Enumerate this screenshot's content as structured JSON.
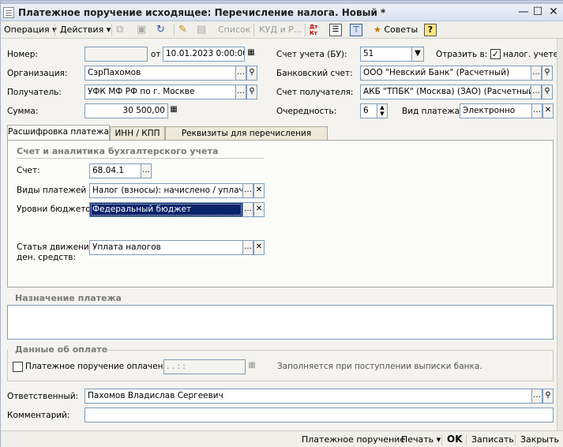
{
  "window": {
    "title": "Платежное поручение исходящее: Перечисление налога. Новый *",
    "controls": [
      "minimize-icon",
      "maximize-icon",
      "close-icon"
    ]
  },
  "toolbar": {
    "operation_label": "Операция",
    "actions_label": "Действия",
    "list_label": "Список",
    "kud_label": "КУД и Р...",
    "dt_kt_label": "Дт Кт",
    "advice_label": "Советы",
    "help_label": "?"
  },
  "header": {
    "number_label": "Номер:",
    "number_value": "",
    "from_label": "от",
    "date_value": "10.01.2023  0:00:00",
    "account_bu_label": "Счет учета (БУ):",
    "account_bu_value": "51",
    "reflect_label": "Отразить в:",
    "tax_account_checked": true,
    "tax_account_label": "налог. учете",
    "org_label": "Организация:",
    "org_value": "СэрПахомов",
    "bank_account_label": "Банковский счет:",
    "bank_account_value": "ООО \"Невский Банк\" (Расчетный)",
    "recipient_label": "Получатель:",
    "recipient_value": "УФК МФ РФ по г. Москве",
    "recipient_account_label": "Счет получателя:",
    "recipient_account_value": "АКБ \"ТПБК\" (Москва) (ЗАО) (Расчетный)",
    "sum_label": "Сумма:",
    "sum_value": "30 500,00",
    "priority_label": "Очередность:",
    "priority_value": "6",
    "payment_type_label": "Вид платежа:",
    "payment_type_value": "Электронно"
  },
  "tabs": [
    {
      "label": "Расшифровка платежа",
      "active": true
    },
    {
      "label": "ИНН / КПП",
      "active": false
    },
    {
      "label": "Реквизиты для перечисления налогов",
      "active": false
    }
  ],
  "panel": {
    "group_title": "Счет и аналитика бухгалтерского учета",
    "account_label": "Счет:",
    "account_value": "68.04.1",
    "payment_kinds_label": "Виды платежей ...",
    "payment_kinds_value": "Налог (взносы): начислено / уплачено",
    "budget_levels_label": "Уровни бюджетов",
    "budget_levels_value": "Федеральный бюджет",
    "cashflow_label_1": "Статья движения",
    "cashflow_label_2": "ден. средств:",
    "cashflow_value": "Уплата налогов"
  },
  "purpose": {
    "title": "Назначение платежа",
    "value": ""
  },
  "payment_data": {
    "title": "Данные об оплате",
    "paid_checked": false,
    "paid_label": "Платежное поручение оплачено:",
    "paid_date_value": " .  .     :  :",
    "hint": "Заполняется при поступлении выписки банка."
  },
  "footer": {
    "responsible_label": "Ответственный:",
    "responsible_value": "Пахомов Владислав Сергеевич",
    "comment_label": "Комментарий:",
    "comment_value": ""
  },
  "statusbar": {
    "payment_order_label": "Платежное поручение",
    "print_label": "Печать",
    "ok_label": "OK",
    "save_label": "Записать",
    "close_label": "Закрыть"
  }
}
